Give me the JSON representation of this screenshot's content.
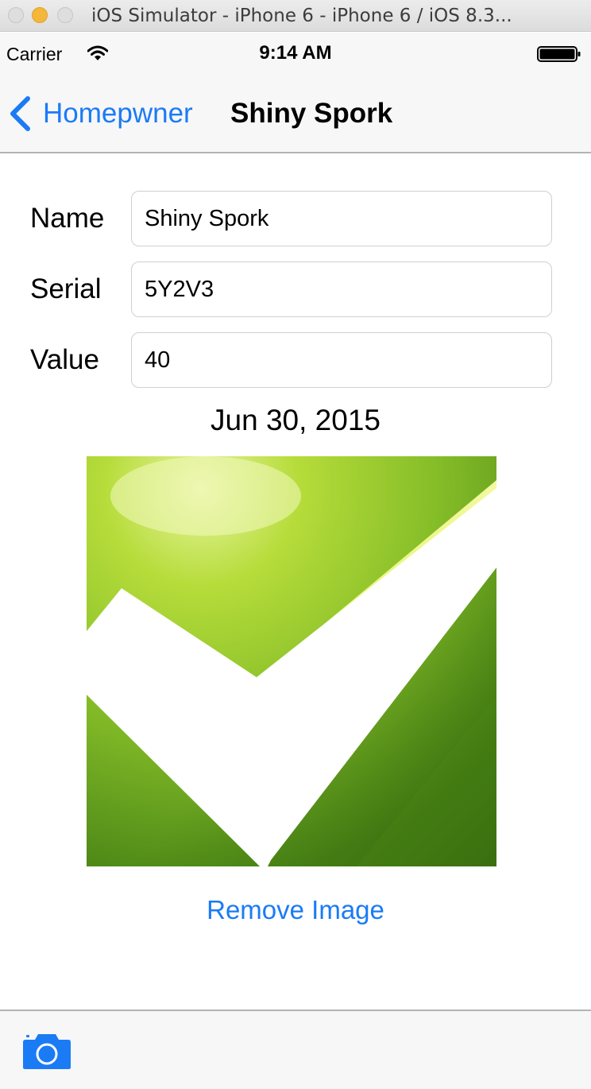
{
  "window": {
    "title": "iOS Simulator - iPhone 6 - iPhone 6 / iOS 8.3..."
  },
  "status_bar": {
    "carrier": "Carrier",
    "time": "9:14 AM",
    "icons": [
      "wifi-icon",
      "battery-icon"
    ]
  },
  "nav_bar": {
    "back_label": "Homepwner",
    "title": "Shiny Spork"
  },
  "form": {
    "name_label": "Name",
    "name_value": "Shiny Spork",
    "serial_label": "Serial",
    "serial_value": "5Y2V3",
    "value_label": "Value",
    "value_value": "40"
  },
  "date_created": "Jun 30, 2015",
  "remove_image_label": "Remove Image",
  "toolbar": {
    "icons": [
      "camera-icon"
    ]
  },
  "colors": {
    "tint": "#1b7bf5",
    "bar_background": "#f7f7f8",
    "photo_green": "#8cc426"
  }
}
